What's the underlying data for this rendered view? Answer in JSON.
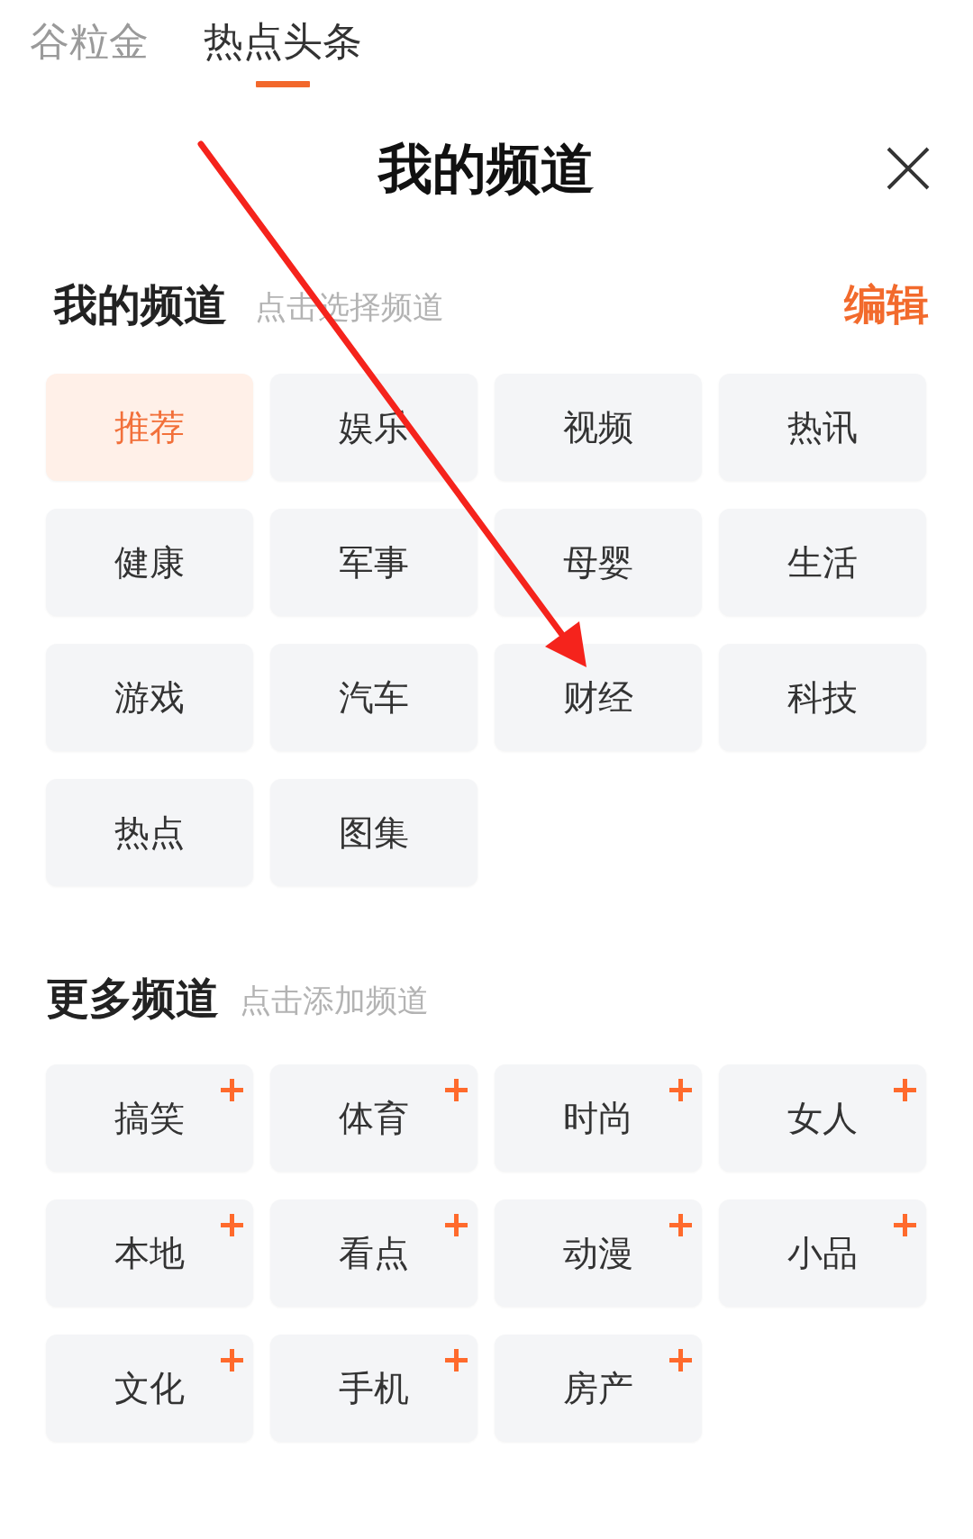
{
  "top_tabs": [
    {
      "label": "谷粒金",
      "selected": false
    },
    {
      "label": "热点头条",
      "selected": true
    }
  ],
  "panel": {
    "title": "我的频道"
  },
  "my_channels": {
    "heading": "我的频道",
    "hint": "点击选择频道",
    "edit": "编辑",
    "items": [
      {
        "label": "推荐",
        "selected": true
      },
      {
        "label": "娱乐",
        "selected": false
      },
      {
        "label": "视频",
        "selected": false
      },
      {
        "label": "热讯",
        "selected": false
      },
      {
        "label": "健康",
        "selected": false
      },
      {
        "label": "军事",
        "selected": false
      },
      {
        "label": "母婴",
        "selected": false
      },
      {
        "label": "生活",
        "selected": false
      },
      {
        "label": "游戏",
        "selected": false
      },
      {
        "label": "汽车",
        "selected": false
      },
      {
        "label": "财经",
        "selected": false
      },
      {
        "label": "科技",
        "selected": false
      },
      {
        "label": "热点",
        "selected": false
      },
      {
        "label": "图集",
        "selected": false
      }
    ]
  },
  "more_channels": {
    "heading": "更多频道",
    "hint": "点击添加频道",
    "items": [
      {
        "label": "搞笑"
      },
      {
        "label": "体育"
      },
      {
        "label": "时尚"
      },
      {
        "label": "女人"
      },
      {
        "label": "本地"
      },
      {
        "label": "看点"
      },
      {
        "label": "动漫"
      },
      {
        "label": "小品"
      },
      {
        "label": "文化"
      },
      {
        "label": "手机"
      },
      {
        "label": "房产"
      }
    ]
  },
  "annotation": {
    "kind": "arrow"
  }
}
